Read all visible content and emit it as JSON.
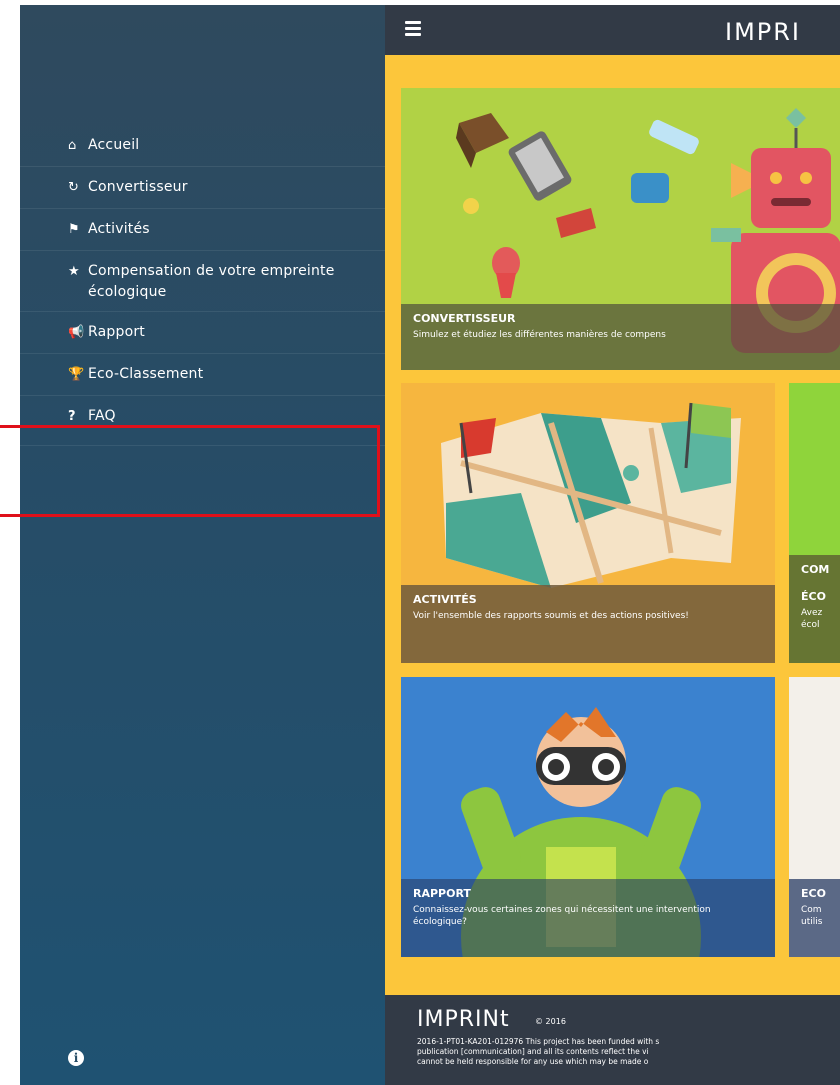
{
  "app": {
    "brand": "IMPRI"
  },
  "sidebar": {
    "items": [
      {
        "icon": "home-icon",
        "label": "Accueil"
      },
      {
        "icon": "refresh-icon",
        "label": "Convertisseur"
      },
      {
        "icon": "flag-icon",
        "label": "Activités"
      },
      {
        "icon": "star-icon",
        "label": "Compensation de votre empreinte écologique"
      },
      {
        "icon": "bullhorn-icon",
        "label": "Rapport"
      },
      {
        "icon": "trophy-icon",
        "label": "Eco-Classement"
      },
      {
        "icon": "question-icon",
        "label": "FAQ"
      }
    ]
  },
  "cards": {
    "convertisseur": {
      "title": "CONVERTISSEUR",
      "desc": "Simulez et étudiez les différentes manières de compens"
    },
    "activites": {
      "title": "ACTIVITÉS",
      "desc": "Voir l'ensemble des rapports soumis et des actions positives!"
    },
    "compensation": {
      "title": "COM",
      "subtitle": "ÉCO",
      "desc": "Avez écol"
    },
    "rapport": {
      "title": "RAPPORT",
      "desc": "Connaissez-vous certaines zones qui nécessitent une intervention écologique?"
    },
    "eco": {
      "title": "ECO",
      "desc": "Com utilis"
    }
  },
  "footer": {
    "logo": "IMPRINt",
    "year": "© 2016",
    "legal": [
      "2016-1-PT01-KA201-012976 This project has been funded with s",
      "publication [communication] and all its contents reflect the vi",
      "cannot be held responsible for any use which may be made o"
    ]
  },
  "colors": {
    "sidebar": "#274c66",
    "main_bg": "#fcc63b",
    "topbar": "#323a46",
    "highlight": "#e0101a"
  }
}
